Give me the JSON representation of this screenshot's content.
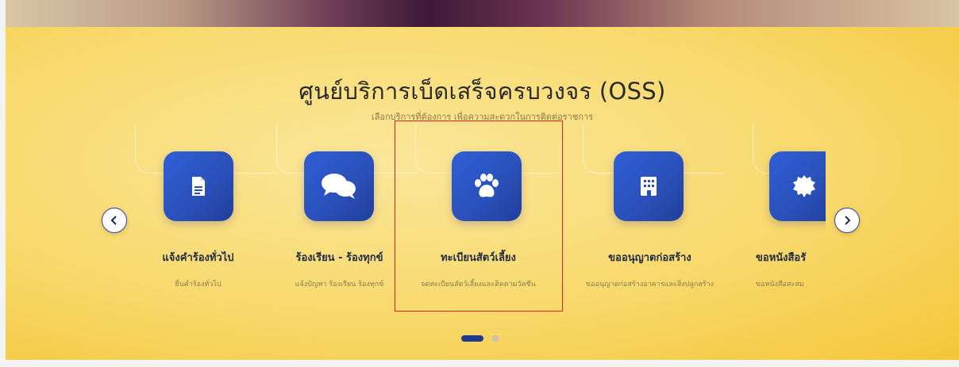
{
  "oss": {
    "title": "ศูนย์บริการเบ็ดเสร็จครบวงจร (OSS)",
    "subtitle": "เลือกบริการที่ต้องการ เพื่อความสะดวกในการติดต่อราชการ"
  },
  "services": [
    {
      "label": "แจ้งคำร้องทั่วไป",
      "desc": "ยื่นคำร้องทั่วไป",
      "icon": "document-icon"
    },
    {
      "label": "ร้องเรียน - ร้องทุกข์",
      "desc": "แจ้งปัญหา ร้องเรียน ร้องทุกข์",
      "icon": "chat-bubbles-icon"
    },
    {
      "label": "ทะเบียนสัตว์เลี้ยง",
      "desc": "จดทะเบียนสัตว์เลี้ยงและติดตามวัคซีน",
      "icon": "paw-icon"
    },
    {
      "label": "ขออนุญาตก่อสร้าง",
      "desc": "ขออนุญาตก่อสร้างอาคารและสิ่งปลูกสร้าง",
      "icon": "building-icon"
    },
    {
      "label": "ขอหนังสือรั",
      "desc": "ขอหนังสือสะสม",
      "icon": "certificate-icon"
    }
  ],
  "carousel": {
    "pages": 2,
    "active_page": 1
  },
  "colors": {
    "panel": "#f8d96c",
    "icon_bg": "#2a4fb8",
    "highlight": "#e02020",
    "dot_active": "#1e3a8a"
  }
}
